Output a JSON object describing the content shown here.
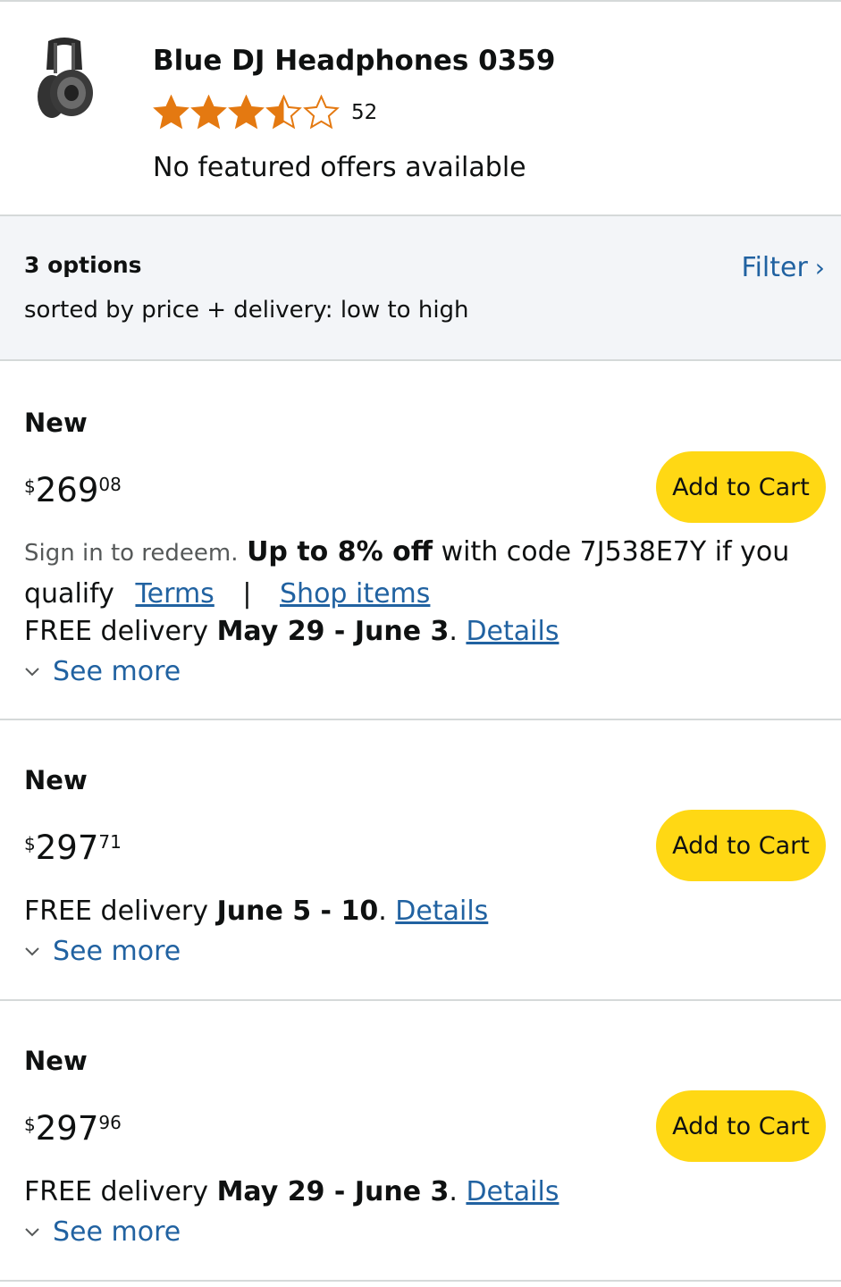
{
  "product": {
    "title": "Blue DJ Headphones 0359",
    "rating_value": 3.5,
    "rating_count": "52",
    "no_offers_text": "No featured offers available",
    "star_color": "#e47911"
  },
  "options": {
    "count_label": "3 options",
    "sort_label": "sorted by price + delivery: low to high",
    "filter_label": "Filter",
    "filter_icon": "chevron-right-icon"
  },
  "offers": [
    {
      "condition": "New",
      "price_symbol": "$",
      "price_whole": "269",
      "price_fraction": "08",
      "add_to_cart_label": "Add to Cart",
      "promo_sign_in": "Sign in to redeem.",
      "promo_bold": "Up to 8% off",
      "promo_rest": "with code 7J538E7Y if you qualify",
      "terms_label": "Terms",
      "separator": "|",
      "shop_items_label": "Shop items",
      "delivery_prefix": "FREE delivery",
      "delivery_dates": "May 29 - June 3",
      "details_label": "Details",
      "see_more_label": "See more"
    },
    {
      "condition": "New",
      "price_symbol": "$",
      "price_whole": "297",
      "price_fraction": "71",
      "add_to_cart_label": "Add to Cart",
      "delivery_prefix": "FREE delivery",
      "delivery_dates": "June 5 - 10",
      "details_label": "Details",
      "see_more_label": "See more"
    },
    {
      "condition": "New",
      "price_symbol": "$",
      "price_whole": "297",
      "price_fraction": "96",
      "add_to_cart_label": "Add to Cart",
      "delivery_prefix": "FREE delivery",
      "delivery_dates": "May 29 - June 3",
      "details_label": "Details",
      "see_more_label": "See more"
    }
  ],
  "colors": {
    "link": "#2162a1",
    "button": "#ffd814",
    "options_bg": "#f3f5f8"
  }
}
